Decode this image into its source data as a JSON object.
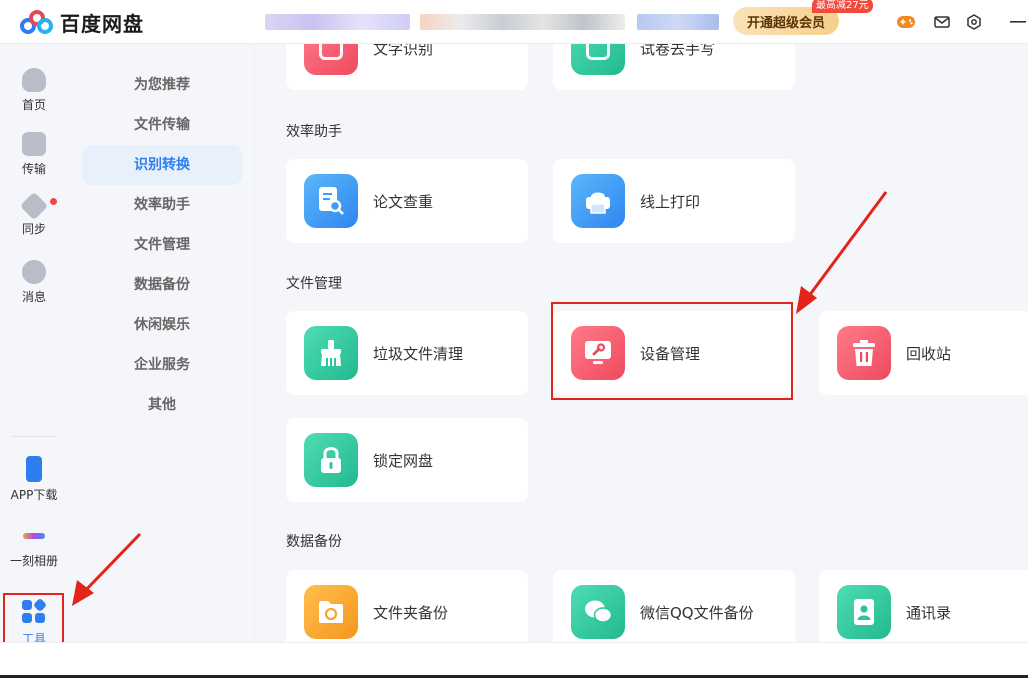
{
  "app": {
    "name": "百度网盘"
  },
  "header": {
    "vip_button": "开通超级会员",
    "vip_badge": "最高减27元",
    "icons": [
      "gamepad-icon",
      "mail-icon",
      "settings-icon",
      "minimize-icon"
    ]
  },
  "rail": {
    "items": [
      {
        "label": "首页",
        "icon": "cloud-icon"
      },
      {
        "label": "传输",
        "icon": "transfer-icon"
      },
      {
        "label": "同步",
        "icon": "sync-icon"
      },
      {
        "label": "消息",
        "icon": "user-icon"
      },
      {
        "label": "APP下载",
        "icon": "phone-icon"
      },
      {
        "label": "一刻相册",
        "icon": "album-icon"
      },
      {
        "label": "工具",
        "icon": "tools-icon"
      }
    ]
  },
  "categories": [
    "为您推荐",
    "文件传输",
    "识别转换",
    "效率助手",
    "文件管理",
    "数据备份",
    "休闲娱乐",
    "企业服务",
    "其他"
  ],
  "active_category": "识别转换",
  "sections": {
    "top_cards": [
      "文字识别",
      "试卷去手写"
    ],
    "efficiency": {
      "title": "效率助手",
      "cards": [
        "论文查重",
        "线上打印"
      ]
    },
    "file_mgmt": {
      "title": "文件管理",
      "cards": [
        "垃圾文件清理",
        "设备管理",
        "回收站",
        "锁定网盘"
      ]
    },
    "backup": {
      "title": "数据备份",
      "cards": [
        "文件夹备份",
        "微信QQ文件备份",
        "通讯录"
      ]
    }
  },
  "colors": {
    "accent": "#2f7ef0",
    "highlight_red": "#e3241b",
    "teal": "#2bc5a0",
    "blue": "#3d9cf5",
    "red": "#f4556a",
    "orange": "#f7a531"
  }
}
